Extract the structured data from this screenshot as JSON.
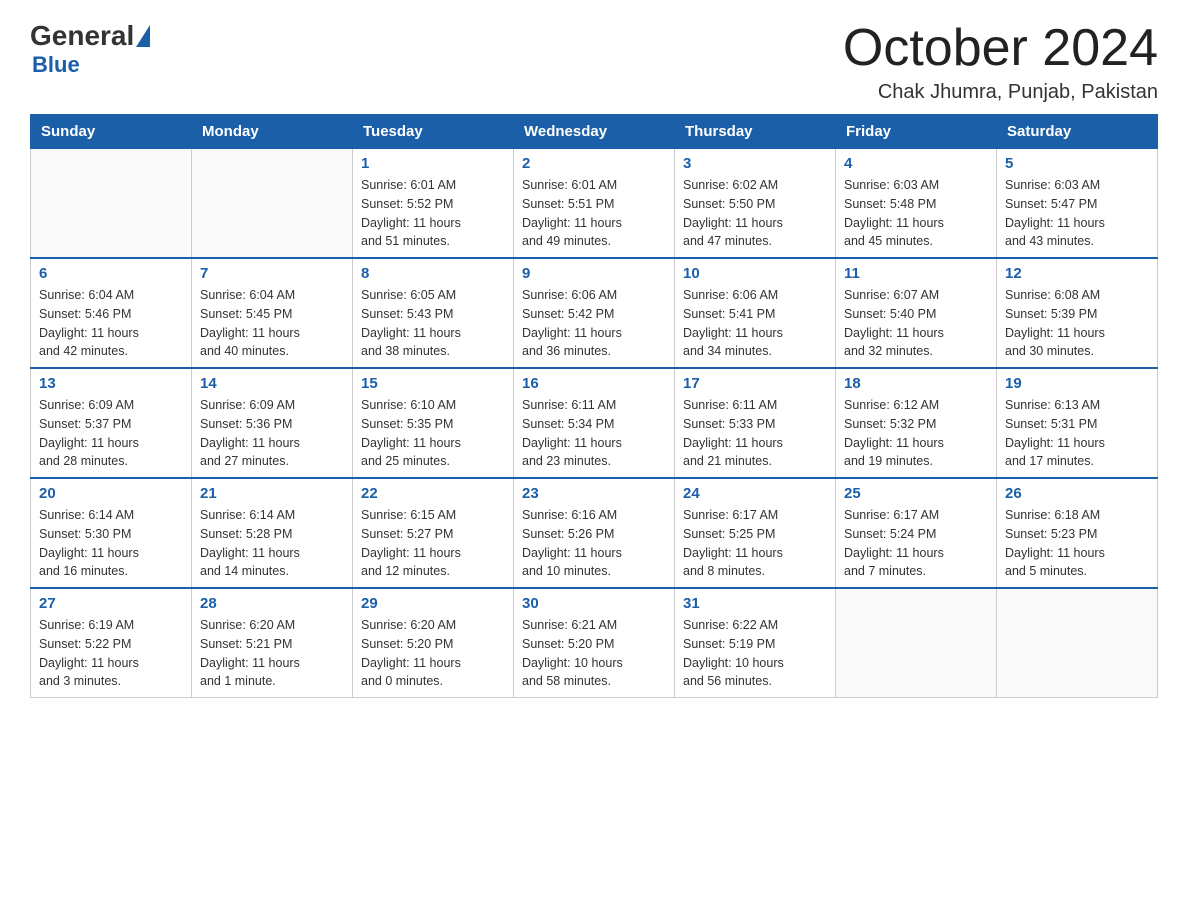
{
  "header": {
    "logo_general": "General",
    "logo_blue": "Blue",
    "month_title": "October 2024",
    "location": "Chak Jhumra, Punjab, Pakistan"
  },
  "weekdays": [
    "Sunday",
    "Monday",
    "Tuesday",
    "Wednesday",
    "Thursday",
    "Friday",
    "Saturday"
  ],
  "weeks": [
    [
      {
        "day": "",
        "info": ""
      },
      {
        "day": "",
        "info": ""
      },
      {
        "day": "1",
        "info": "Sunrise: 6:01 AM\nSunset: 5:52 PM\nDaylight: 11 hours\nand 51 minutes."
      },
      {
        "day": "2",
        "info": "Sunrise: 6:01 AM\nSunset: 5:51 PM\nDaylight: 11 hours\nand 49 minutes."
      },
      {
        "day": "3",
        "info": "Sunrise: 6:02 AM\nSunset: 5:50 PM\nDaylight: 11 hours\nand 47 minutes."
      },
      {
        "day": "4",
        "info": "Sunrise: 6:03 AM\nSunset: 5:48 PM\nDaylight: 11 hours\nand 45 minutes."
      },
      {
        "day": "5",
        "info": "Sunrise: 6:03 AM\nSunset: 5:47 PM\nDaylight: 11 hours\nand 43 minutes."
      }
    ],
    [
      {
        "day": "6",
        "info": "Sunrise: 6:04 AM\nSunset: 5:46 PM\nDaylight: 11 hours\nand 42 minutes."
      },
      {
        "day": "7",
        "info": "Sunrise: 6:04 AM\nSunset: 5:45 PM\nDaylight: 11 hours\nand 40 minutes."
      },
      {
        "day": "8",
        "info": "Sunrise: 6:05 AM\nSunset: 5:43 PM\nDaylight: 11 hours\nand 38 minutes."
      },
      {
        "day": "9",
        "info": "Sunrise: 6:06 AM\nSunset: 5:42 PM\nDaylight: 11 hours\nand 36 minutes."
      },
      {
        "day": "10",
        "info": "Sunrise: 6:06 AM\nSunset: 5:41 PM\nDaylight: 11 hours\nand 34 minutes."
      },
      {
        "day": "11",
        "info": "Sunrise: 6:07 AM\nSunset: 5:40 PM\nDaylight: 11 hours\nand 32 minutes."
      },
      {
        "day": "12",
        "info": "Sunrise: 6:08 AM\nSunset: 5:39 PM\nDaylight: 11 hours\nand 30 minutes."
      }
    ],
    [
      {
        "day": "13",
        "info": "Sunrise: 6:09 AM\nSunset: 5:37 PM\nDaylight: 11 hours\nand 28 minutes."
      },
      {
        "day": "14",
        "info": "Sunrise: 6:09 AM\nSunset: 5:36 PM\nDaylight: 11 hours\nand 27 minutes."
      },
      {
        "day": "15",
        "info": "Sunrise: 6:10 AM\nSunset: 5:35 PM\nDaylight: 11 hours\nand 25 minutes."
      },
      {
        "day": "16",
        "info": "Sunrise: 6:11 AM\nSunset: 5:34 PM\nDaylight: 11 hours\nand 23 minutes."
      },
      {
        "day": "17",
        "info": "Sunrise: 6:11 AM\nSunset: 5:33 PM\nDaylight: 11 hours\nand 21 minutes."
      },
      {
        "day": "18",
        "info": "Sunrise: 6:12 AM\nSunset: 5:32 PM\nDaylight: 11 hours\nand 19 minutes."
      },
      {
        "day": "19",
        "info": "Sunrise: 6:13 AM\nSunset: 5:31 PM\nDaylight: 11 hours\nand 17 minutes."
      }
    ],
    [
      {
        "day": "20",
        "info": "Sunrise: 6:14 AM\nSunset: 5:30 PM\nDaylight: 11 hours\nand 16 minutes."
      },
      {
        "day": "21",
        "info": "Sunrise: 6:14 AM\nSunset: 5:28 PM\nDaylight: 11 hours\nand 14 minutes."
      },
      {
        "day": "22",
        "info": "Sunrise: 6:15 AM\nSunset: 5:27 PM\nDaylight: 11 hours\nand 12 minutes."
      },
      {
        "day": "23",
        "info": "Sunrise: 6:16 AM\nSunset: 5:26 PM\nDaylight: 11 hours\nand 10 minutes."
      },
      {
        "day": "24",
        "info": "Sunrise: 6:17 AM\nSunset: 5:25 PM\nDaylight: 11 hours\nand 8 minutes."
      },
      {
        "day": "25",
        "info": "Sunrise: 6:17 AM\nSunset: 5:24 PM\nDaylight: 11 hours\nand 7 minutes."
      },
      {
        "day": "26",
        "info": "Sunrise: 6:18 AM\nSunset: 5:23 PM\nDaylight: 11 hours\nand 5 minutes."
      }
    ],
    [
      {
        "day": "27",
        "info": "Sunrise: 6:19 AM\nSunset: 5:22 PM\nDaylight: 11 hours\nand 3 minutes."
      },
      {
        "day": "28",
        "info": "Sunrise: 6:20 AM\nSunset: 5:21 PM\nDaylight: 11 hours\nand 1 minute."
      },
      {
        "day": "29",
        "info": "Sunrise: 6:20 AM\nSunset: 5:20 PM\nDaylight: 11 hours\nand 0 minutes."
      },
      {
        "day": "30",
        "info": "Sunrise: 6:21 AM\nSunset: 5:20 PM\nDaylight: 10 hours\nand 58 minutes."
      },
      {
        "day": "31",
        "info": "Sunrise: 6:22 AM\nSunset: 5:19 PM\nDaylight: 10 hours\nand 56 minutes."
      },
      {
        "day": "",
        "info": ""
      },
      {
        "day": "",
        "info": ""
      }
    ]
  ]
}
